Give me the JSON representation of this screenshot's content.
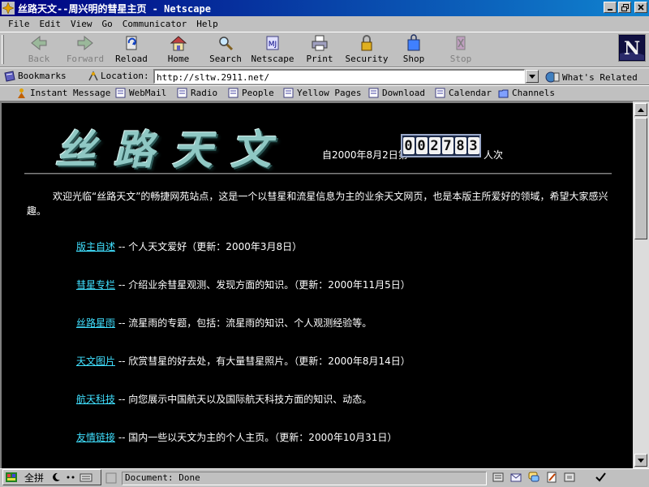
{
  "window": {
    "title": "丝路天文--周兴明的彗星主页 - Netscape"
  },
  "menu": [
    "File",
    "Edit",
    "View",
    "Go",
    "Communicator",
    "Help"
  ],
  "nav": {
    "back": "Back",
    "forward": "Forward",
    "reload": "Reload",
    "home": "Home",
    "search": "Search",
    "netscape": "Netscape",
    "print": "Print",
    "security": "Security",
    "shop": "Shop",
    "stop": "Stop"
  },
  "location": {
    "bookmarks": "Bookmarks",
    "label": "Location:",
    "url": "http://sltw.2911.net/",
    "whats_related": "What's Related"
  },
  "personal": [
    "Instant Message",
    "WebMail",
    "Radio",
    "People",
    "Yellow Pages",
    "Download",
    "Calendar",
    "Channels"
  ],
  "page": {
    "banner": "丝路天文",
    "counter_prefix": "自2000年8月2日第",
    "counter_digits": [
      "0",
      "0",
      "2",
      "7",
      "8",
      "3"
    ],
    "counter_suffix": "人次",
    "intro": "欢迎光临“丝路天文”的畅捷网苑站点，这是一个以彗星和流星信息为主的业余天文网页，也是本版主所爱好的领域，希望大家感兴趣。",
    "links": [
      {
        "label": "版主自述",
        "desc": " -- 个人天文爱好（更新：2000年3月8日）"
      },
      {
        "label": "彗星专栏",
        "desc": " -- 介绍业余彗星观测、发现方面的知识。（更新：2000年11月5日）"
      },
      {
        "label": "丝路星雨",
        "desc": " -- 流星雨的专题，包括：流星雨的知识、个人观测经验等。"
      },
      {
        "label": "天文图片",
        "desc": " -- 欣赏彗星的好去处，有大量彗星照片。（更新：2000年8月14日）"
      },
      {
        "label": "航天科技",
        "desc": " -- 向您展示中国航天以及国际航天科技方面的知识、动态。"
      },
      {
        "label": "友情链接",
        "desc": " -- 国内一些以天文为主的个人主页。（更新：2000年10月31日）"
      }
    ]
  },
  "status": {
    "text": "Document: Done",
    "ime_label": "全拼"
  }
}
